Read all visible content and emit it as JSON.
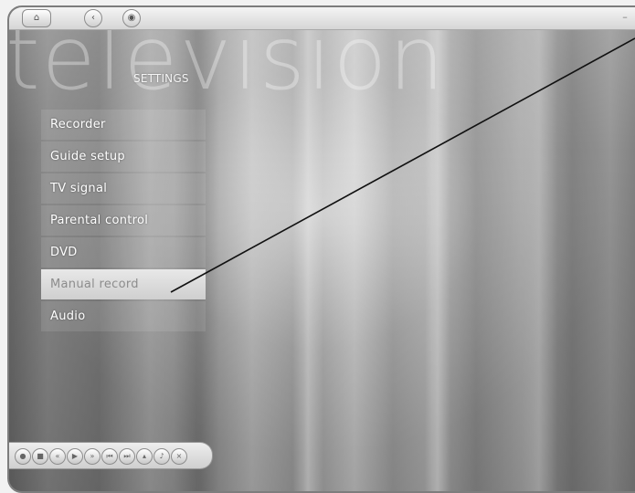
{
  "window": {
    "watermark": "television",
    "section_title": "SETTINGS"
  },
  "titlebar": {
    "home_icon": "home-icon",
    "back_icon": "back-icon",
    "media_icon": "media-icon",
    "minimize_icon": "minimize-icon"
  },
  "menu": {
    "items": [
      {
        "label": "Recorder",
        "selected": false
      },
      {
        "label": "Guide setup",
        "selected": false
      },
      {
        "label": "TV signal",
        "selected": false
      },
      {
        "label": "Parental control",
        "selected": false
      },
      {
        "label": "DVD",
        "selected": false
      },
      {
        "label": "Manual record",
        "selected": true
      },
      {
        "label": "Audio",
        "selected": false
      }
    ]
  },
  "transport": {
    "buttons": [
      "record-icon",
      "stop-icon",
      "rewind-icon",
      "play-icon",
      "fast-forward-icon",
      "skip-back-icon",
      "skip-forward-icon",
      "channel-icon",
      "volume-icon",
      "mute-icon"
    ]
  },
  "colors": {
    "selected_bg": "#d9d9d9",
    "menu_text": "#ffffff",
    "frame_border": "#7d7d7d",
    "callout_line": "#111111"
  }
}
